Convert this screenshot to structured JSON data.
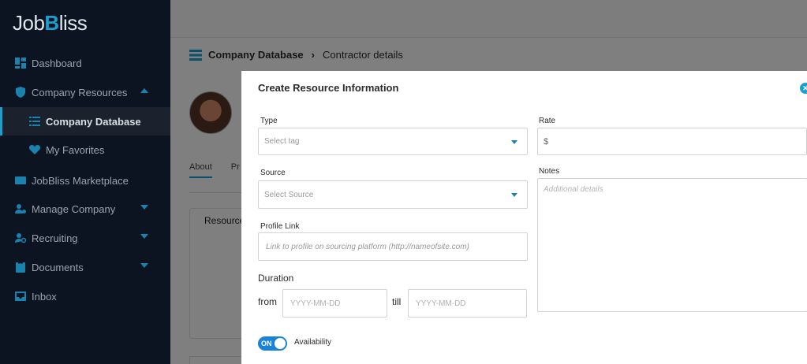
{
  "app": {
    "logo_text": "JobBliss"
  },
  "sidebar": {
    "items": [
      {
        "label": "Dashboard",
        "icon": "dashboard-icon"
      },
      {
        "label": "Company Resources",
        "icon": "shield-check-icon"
      },
      {
        "label": "Company Database",
        "icon": "list-icon"
      },
      {
        "label": "My Favorites",
        "icon": "heart-icon"
      },
      {
        "label": "JobBliss Marketplace",
        "icon": "id-card-icon"
      },
      {
        "label": "Manage Company",
        "icon": "users-gear-icon"
      },
      {
        "label": "Recruiting",
        "icon": "user-search-icon"
      },
      {
        "label": "Documents",
        "icon": "clipboard-icon"
      },
      {
        "label": "Inbox",
        "icon": "inbox-icon"
      }
    ]
  },
  "breadcrumb": {
    "parent": "Company Database",
    "current": "Contractor details"
  },
  "background": {
    "tab_about": "About",
    "tab_partial": "Pr",
    "card_title": "Resource"
  },
  "modal": {
    "title": "Create Resource Information",
    "type_label": "Type",
    "type_placeholder": "Select tag",
    "source_label": "Source",
    "source_placeholder": "Select Source",
    "profile_label": "Profile Link",
    "profile_placeholder": "Link to profile on sourcing platform (http://nameofsite.com)",
    "duration_label": "Duration",
    "from_label": "from",
    "till_label": "till",
    "from_placeholder": "YYYY-MM-DD",
    "till_placeholder": "YYYY-MM-DD",
    "rate_label": "Rate",
    "rate_prefix": "$",
    "notes_label": "Notes",
    "notes_placeholder": "Additional details",
    "toggle_state": "ON",
    "availability_label": "Availability"
  },
  "colors": {
    "accent": "#1a9fcf",
    "sidebar_bg": "#0d1421",
    "toggle_on": "#1a83d9"
  }
}
